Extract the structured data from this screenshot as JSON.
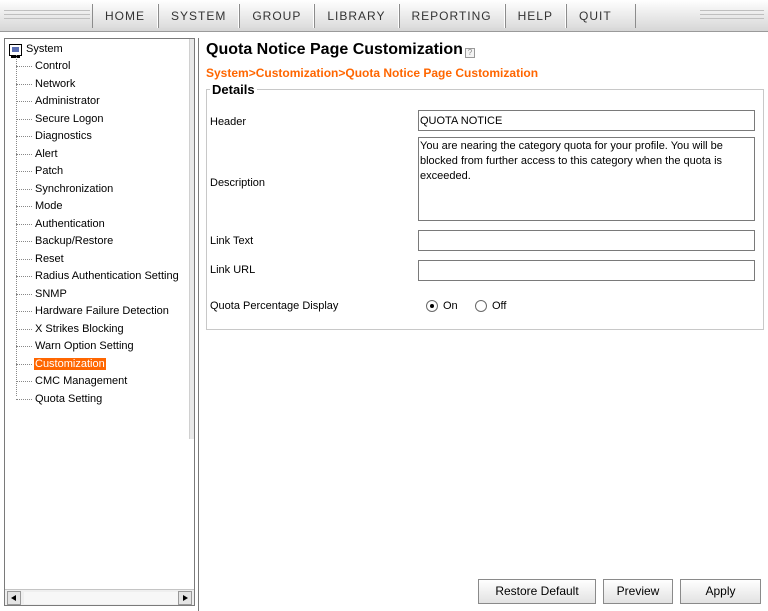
{
  "menu": {
    "items": [
      "HOME",
      "SYSTEM",
      "GROUP",
      "LIBRARY",
      "REPORTING",
      "HELP",
      "QUIT"
    ]
  },
  "tree": {
    "root": "System",
    "items": [
      {
        "label": "Control",
        "selected": false
      },
      {
        "label": "Network",
        "selected": false
      },
      {
        "label": "Administrator",
        "selected": false
      },
      {
        "label": "Secure Logon",
        "selected": false
      },
      {
        "label": "Diagnostics",
        "selected": false
      },
      {
        "label": "Alert",
        "selected": false
      },
      {
        "label": "Patch",
        "selected": false
      },
      {
        "label": "Synchronization",
        "selected": false
      },
      {
        "label": "Mode",
        "selected": false
      },
      {
        "label": "Authentication",
        "selected": false
      },
      {
        "label": "Backup/Restore",
        "selected": false
      },
      {
        "label": "Reset",
        "selected": false
      },
      {
        "label": "Radius Authentication Setting",
        "selected": false
      },
      {
        "label": "SNMP",
        "selected": false
      },
      {
        "label": "Hardware Failure Detection",
        "selected": false
      },
      {
        "label": "X Strikes Blocking",
        "selected": false
      },
      {
        "label": "Warn Option Setting",
        "selected": false
      },
      {
        "label": "Customization",
        "selected": true
      },
      {
        "label": "CMC Management",
        "selected": false
      },
      {
        "label": "Quota Setting",
        "selected": false
      }
    ]
  },
  "page": {
    "title": "Quota Notice Page Customization",
    "breadcrumb": "System>Customization>Quota Notice Page Customization"
  },
  "details": {
    "legend": "Details",
    "header_label": "Header",
    "header_value": "QUOTA NOTICE",
    "description_label": "Description",
    "description_value": "You are nearing the category quota for your profile. You will be blocked from further access to this category when the quota is exceeded.",
    "link_text_label": "Link Text",
    "link_text_value": "",
    "link_url_label": "Link URL",
    "link_url_value": "",
    "quota_display_label": "Quota Percentage Display",
    "quota_display_options": [
      "On",
      "Off"
    ],
    "quota_display_selected": "On"
  },
  "buttons": {
    "restore_default": "Restore Default",
    "preview": "Preview",
    "apply": "Apply"
  },
  "colors": {
    "accent": "#ff6600",
    "selected_bg": "#ff6600"
  },
  "icons": {
    "tree_root": "computer-icon",
    "title_help": "help-icon"
  }
}
